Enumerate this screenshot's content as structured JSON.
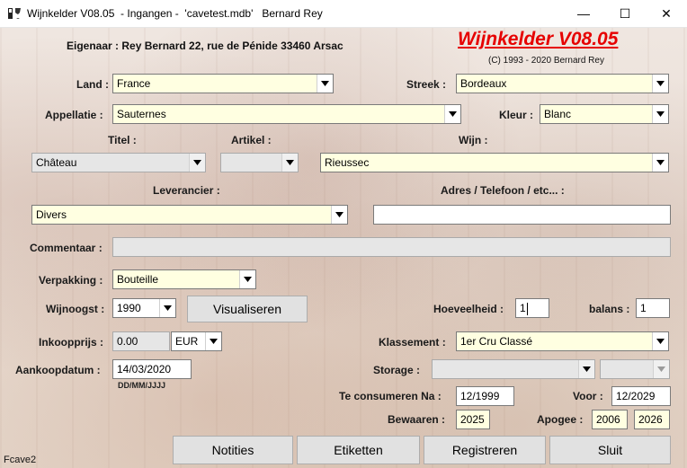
{
  "window": {
    "title": "Wijnkelder V08.05  - Ingangen -  'cavetest.mdb'   Bernard Rey",
    "minimize": "—",
    "maximize": "☐",
    "close": "✕"
  },
  "header": {
    "owner": "Eigenaar : Rey Bernard 22, rue de Pénide 33460 Arsac",
    "brand": "Wijnkelder V08.05",
    "copyright": "(C) 1993 - 2020 Bernard Rey"
  },
  "labels": {
    "land": "Land :",
    "streek": "Streek :",
    "appellatie": "Appellatie :",
    "kleur": "Kleur :",
    "titel": "Titel :",
    "artikel": "Artikel :",
    "wijn": "Wijn :",
    "leverancier": "Leverancier :",
    "adres": "Adres / Telefoon / etc... :",
    "commentaar": "Commentaar :",
    "verpakking": "Verpakking :",
    "wijnoogst": "Wijnoogst :",
    "hoeveelheid": "Hoeveelheid :",
    "balans": "balans :",
    "inkoopprijs": "Inkoopprijs :",
    "klassement": "Klassement :",
    "aankoopdatum": "Aankoopdatum :",
    "date_format": "DD/MM/JJJJ",
    "storage": "Storage :",
    "te_consumeren": "Te consumeren Na :",
    "voor": "Voor :",
    "bewaaren": "Bewaaren :",
    "apogee": "Apogee :"
  },
  "fields": {
    "land": "France",
    "streek": "Bordeaux",
    "appellatie": "Sauternes",
    "kleur": "Blanc",
    "titel": "Château",
    "artikel": "",
    "wijn": "Rieussec",
    "leverancier": "Divers",
    "adres": "",
    "commentaar": "",
    "verpakking": "Bouteille",
    "wijnoogst": "1990",
    "hoeveelheid": "1",
    "balans": "1",
    "inkoopprijs": "0.00",
    "currency": "EUR",
    "klassement": "1er Cru Classé",
    "aankoopdatum": "14/03/2020",
    "storage": "",
    "storage2": "",
    "te_consumeren": "12/1999",
    "voor": "12/2029",
    "bewaaren": "2025",
    "apogee_from": "2006",
    "apogee_to": "2026"
  },
  "buttons": {
    "visualiseren": "Visualiseren",
    "notities": "Notities",
    "etiketten": "Etiketten",
    "registreren": "Registreren",
    "sluit": "Sluit"
  },
  "footer": {
    "form_name": "Fcave2"
  }
}
